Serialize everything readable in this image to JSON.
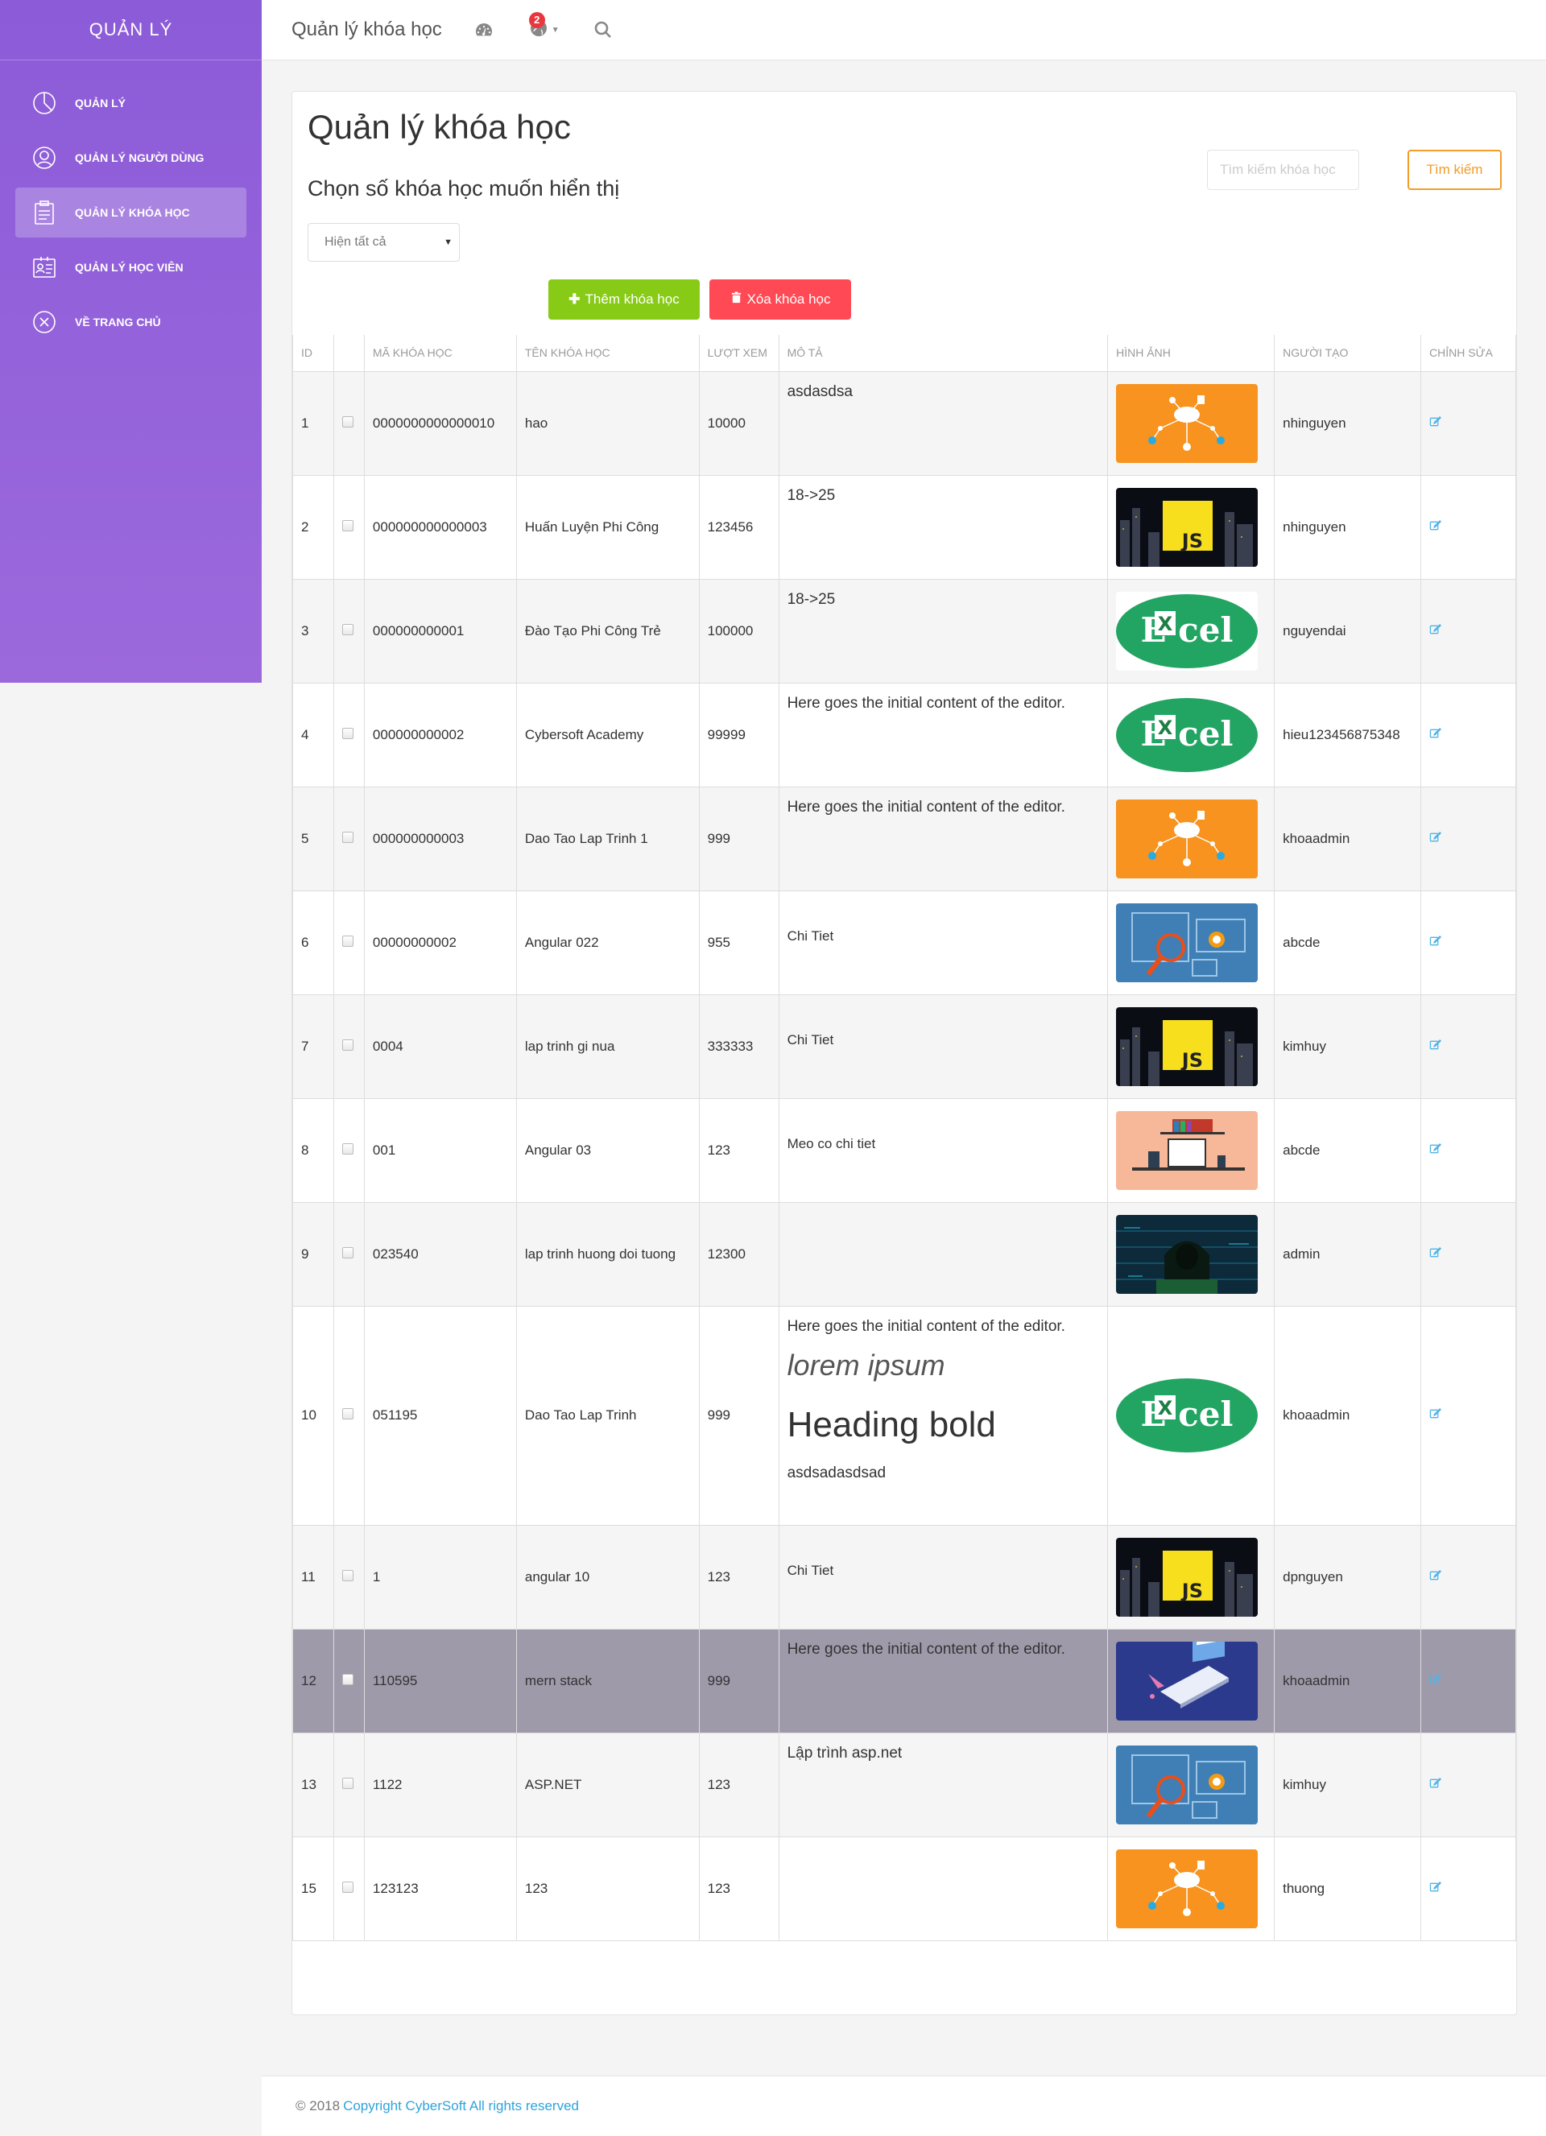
{
  "sidebar": {
    "logo": "QUẢN LÝ",
    "items": [
      {
        "label": "QUẢN LÝ",
        "icon": "pie-chart-icon",
        "active": false
      },
      {
        "label": "QUẢN LÝ NGƯỜI DÙNG",
        "icon": "user-icon",
        "active": false
      },
      {
        "label": "QUẢN LÝ KHÓA HỌC",
        "icon": "clipboard-icon",
        "active": true
      },
      {
        "label": "QUẢN LÝ HỌC VIÊN",
        "icon": "id-card-icon",
        "active": false
      },
      {
        "label": "VỀ TRANG CHỦ",
        "icon": "close-circle-icon",
        "active": false
      }
    ]
  },
  "topbar": {
    "title": "Quản lý khóa học",
    "notification_count": "2",
    "icons": [
      "dashboard-icon",
      "globe-icon",
      "search-icon"
    ]
  },
  "main": {
    "title": "Quản lý khóa học",
    "subtitle": "Chọn số khóa học muốn hiển thị",
    "select_value": "Hiện tất cả",
    "search_placeholder": "Tìm kiếm khóa học",
    "search_button": "Tìm kiếm",
    "add_button": "Thêm khóa học",
    "delete_button": "Xóa khóa học",
    "columns": [
      "ID",
      "",
      "MÃ KHÓA HỌC",
      "TÊN KHÓA HỌC",
      "LƯỢT XEM",
      "MÔ TẢ",
      "HÌNH ẢNH",
      "NGƯỜI TẠO",
      "CHỈNH SỬA"
    ],
    "rows": [
      {
        "id": "1",
        "code": "0000000000000010",
        "name": "hao",
        "views": "10000",
        "desc": [
          "asdasdsa"
        ],
        "image": "cloud-network",
        "creator": "nhinguyen"
      },
      {
        "id": "2",
        "code": "000000000000003",
        "name": "Huấn Luyện Phi Công",
        "views": "123456",
        "desc": [
          "18->25"
        ],
        "image": "js",
        "creator": "nhinguyen"
      },
      {
        "id": "3",
        "code": "000000000001",
        "name": "Đào Tạo Phi Công Trẻ",
        "views": "100000",
        "desc": [
          "18->25"
        ],
        "image": "excel",
        "creator": "nguyendai"
      },
      {
        "id": "4",
        "code": "000000000002",
        "name": "Cybersoft Academy",
        "views": "99999",
        "desc": [
          "Here goes the initial content of the editor."
        ],
        "image": "excel",
        "creator": "hieu123456875348"
      },
      {
        "id": "5",
        "code": "000000000003",
        "name": "Dao Tao Lap Trinh 1",
        "views": "999",
        "desc": [
          "Here goes the initial content of the editor."
        ],
        "image": "cloud-network",
        "creator": "khoaadmin"
      },
      {
        "id": "6",
        "code": "00000000002",
        "name": "Angular 022",
        "views": "955",
        "desc": [
          "Chi Tiet"
        ],
        "image": "seo",
        "creator": "abcde"
      },
      {
        "id": "7",
        "code": "0004",
        "name": "lap trinh gi nua",
        "views": "333333",
        "desc": [
          "Chi Tiet"
        ],
        "image": "js",
        "creator": "kimhuy"
      },
      {
        "id": "8",
        "code": "001",
        "name": "Angular 03",
        "views": "123",
        "desc": [
          "Meo co chi tiet"
        ],
        "image": "desk",
        "creator": "abcde"
      },
      {
        "id": "9",
        "code": "023540",
        "name": "lap trinh huong doi tuong",
        "views": "12300",
        "desc": [
          ""
        ],
        "image": "hacker",
        "creator": "admin"
      },
      {
        "id": "10",
        "code": "051195",
        "name": "Dao Tao Lap Trinh",
        "views": "999",
        "desc": [
          "Here goes the initial content of the editor.",
          "lorem ipsum",
          "Heading bold",
          "asdsadasdsad"
        ],
        "image": "excel",
        "creator": "khoaadmin"
      },
      {
        "id": "11",
        "code": "1",
        "name": "angular 10",
        "views": "123",
        "desc": [
          "Chi Tiet"
        ],
        "image": "js",
        "creator": "dpnguyen"
      },
      {
        "id": "12",
        "code": "110595",
        "name": "mern stack",
        "views": "999",
        "desc": [
          "Here goes the initial content of the editor."
        ],
        "image": "laptop",
        "creator": "khoaadmin"
      },
      {
        "id": "13",
        "code": "1122",
        "name": "ASP.NET",
        "views": "123",
        "desc": [
          "Lập trình  asp.net"
        ],
        "image": "seo",
        "creator": "kimhuy"
      },
      {
        "id": "15",
        "code": "123123",
        "name": "123",
        "views": "123",
        "desc": [
          ""
        ],
        "image": "cloud-network",
        "creator": "thuong"
      }
    ]
  },
  "footer": {
    "copyright": "© 2018",
    "link": "Copyright CyberSoft All rights reserved"
  }
}
